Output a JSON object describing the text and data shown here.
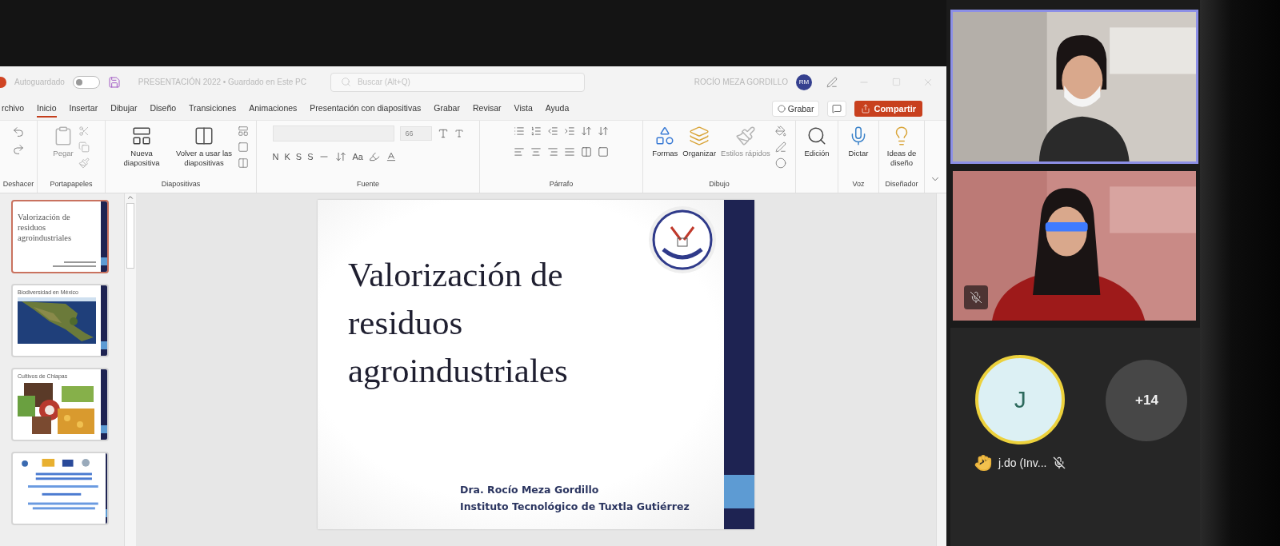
{
  "title_bar": {
    "autosave_label": "Autoguardado",
    "autosave_on": false,
    "document_title": "PRESENTACIÓN 2022 • Guardado en Este PC",
    "search_placeholder": "Buscar (Alt+Q)",
    "user_name": "ROCÍO MEZA GORDILLO",
    "user_initials": "RM"
  },
  "menu_tabs": [
    {
      "label": "rchivo",
      "selected": false
    },
    {
      "label": "Inicio",
      "selected": true
    },
    {
      "label": "Insertar",
      "selected": false
    },
    {
      "label": "Dibujar",
      "selected": false
    },
    {
      "label": "Diseño",
      "selected": false
    },
    {
      "label": "Transiciones",
      "selected": false
    },
    {
      "label": "Animaciones",
      "selected": false
    },
    {
      "label": "Presentación con diapositivas",
      "selected": false
    },
    {
      "label": "Grabar",
      "selected": false
    },
    {
      "label": "Revisar",
      "selected": false
    },
    {
      "label": "Vista",
      "selected": false
    },
    {
      "label": "Ayuda",
      "selected": false
    }
  ],
  "record_button": "Grabar",
  "share_button": "Compartir",
  "ribbon_groups": [
    {
      "kind": "undo",
      "label": "Deshacer"
    },
    {
      "kind": "clipboard",
      "label": "Portapapeles",
      "commands": [
        {
          "label": "Pegar",
          "disabled": true
        }
      ]
    },
    {
      "kind": "slides",
      "label": "Diapositivas",
      "commands": [
        {
          "label": "Nueva diapositiva",
          "disabled": false
        },
        {
          "label": "Volver a usar las diapositivas",
          "disabled": false
        }
      ]
    },
    {
      "kind": "font",
      "label": "Fuente",
      "font_size": "66",
      "format_buttons": [
        "N",
        "K",
        "S",
        "S"
      ],
      "case_button": "Aa"
    },
    {
      "kind": "paragraph",
      "label": "Párrafo"
    },
    {
      "kind": "drawing",
      "label": "Dibujo",
      "commands": [
        {
          "label": "Formas",
          "disabled": false
        },
        {
          "label": "Organizar",
          "disabled": false
        },
        {
          "label": "Estilos rápidos",
          "disabled": true
        }
      ]
    },
    {
      "kind": "editing",
      "commands": [
        {
          "label": "Edición",
          "disabled": false
        }
      ]
    },
    {
      "kind": "voice",
      "label": "Voz",
      "commands": [
        {
          "label": "Dictar",
          "disabled": false
        }
      ]
    },
    {
      "kind": "designer",
      "label": "Diseñador",
      "commands": [
        {
          "label": "Ideas de diseño",
          "disabled": false
        }
      ]
    }
  ],
  "slide_thumbnails": [
    {
      "kind": "title",
      "title": "Valorización de residuos agroindustriales",
      "selected": true
    },
    {
      "kind": "map",
      "title": "Biodiversidad en México",
      "selected": false
    },
    {
      "kind": "photos",
      "title": "Cultivos de Chiapas",
      "selected": false
    },
    {
      "kind": "logos",
      "selected": false
    }
  ],
  "slide": {
    "title": "Valorización de residuos agroindustriales",
    "author": "Dra. Rocío Meza Gordillo",
    "institution": "Instituto Tecnológico de Tuxtla Gutiérrez"
  },
  "participants": [
    {
      "kind": "video",
      "active": true,
      "muted": false
    },
    {
      "kind": "video",
      "active": false,
      "muted": true
    },
    {
      "kind": "avatar",
      "initial": "J",
      "name": "j.do (Inv...",
      "hand_raised": true,
      "muted": true
    }
  ],
  "more_participants": "+14"
}
